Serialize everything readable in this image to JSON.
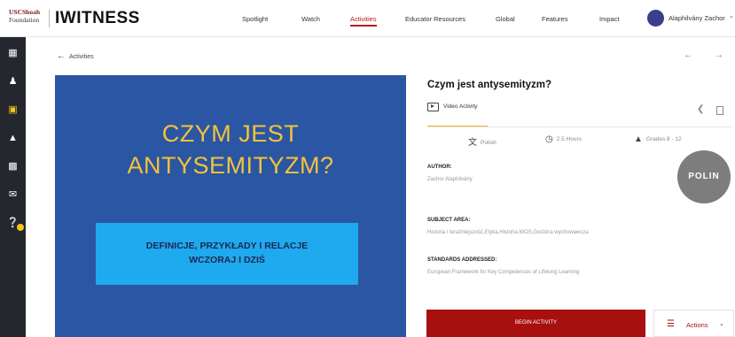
{
  "header": {
    "logo_usc_line1": "USCShoah",
    "logo_usc_line2": "Foundation",
    "logo_iwitness": "IWITNESS",
    "nav": [
      "Spotlight",
      "Watch",
      "Activities",
      "Educator Resources",
      "Global",
      "Features",
      "Impact"
    ],
    "active_nav": "Activities",
    "user_name": "Alaphilvány Zachor",
    "accent_color": "#b41c1c"
  },
  "sidebar": {
    "icons": [
      "dashboard-icon",
      "users-icon",
      "briefcase-icon",
      "school-icon",
      "archive-icon",
      "messages-icon",
      "help-icon"
    ],
    "active_index": 2,
    "active_color": "#f5c518"
  },
  "breadcrumb": {
    "back_label": "Activities"
  },
  "hero": {
    "title_line1": "CZYM JEST",
    "title_line2": "ANTYSEMITYZM?",
    "subtitle_line1": "DEFINICJE, PRZYKŁADY I RELACJE",
    "subtitle_line2": "WCZORAJ I DZIŚ",
    "background": "#2b56a3",
    "box_color": "#1fa9ee",
    "title_color": "#f2c33b"
  },
  "activity": {
    "title": "Czym jest antysemityzm?",
    "type": "Video Activity",
    "language": "Polish",
    "duration": "2.5 Hours",
    "grades": "Grades 8 - 12",
    "author_label": "AUTHOR:",
    "author": "Zachor Alaphilvány",
    "subject_label": "SUBJECT AREA:",
    "subject": "Historia i teraźniejszość,Etyka,Historia,WOS,Godzina wychowawcza",
    "standards_label": "STANDARDS ADDRESSED:",
    "standards": "European Framework for Key Competences of Lifelong Learning",
    "partner_logo": "POLIN",
    "begin_label": "BEGIN ACTIVITY",
    "actions_label": "Actions"
  }
}
